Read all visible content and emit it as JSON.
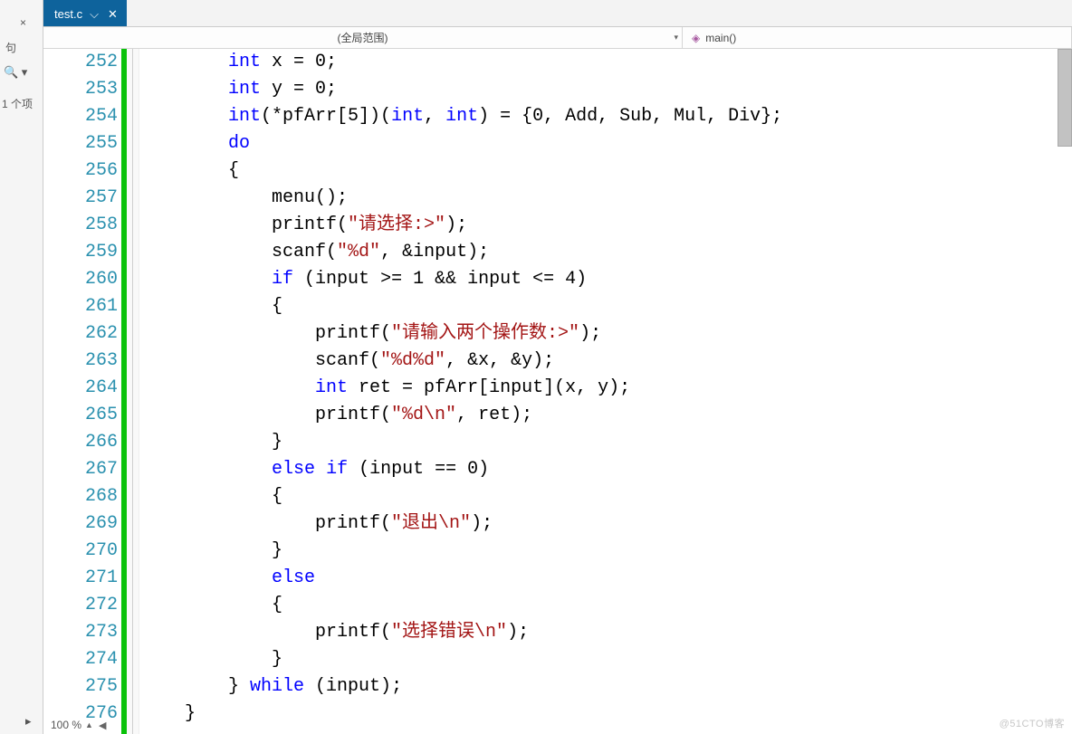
{
  "left_panel": {
    "close_x": "×",
    "char_label": "句",
    "search_glyph": "🔍 ▾",
    "project_fragment": "1 个项",
    "expand_glyph": "▸"
  },
  "tabs": {
    "active": {
      "label": "test.c",
      "pin_glyph": "⌵",
      "close_glyph": "✕"
    }
  },
  "scope_bar": {
    "global_label": "(全局范围)",
    "func_icon": "◈",
    "func_label": "main()",
    "drop_glyph": "▾"
  },
  "code": [
    {
      "num": 252,
      "seg": [
        {
          "t": "        "
        },
        {
          "t": "int",
          "c": "kw"
        },
        {
          "t": " x = 0;"
        }
      ]
    },
    {
      "num": 253,
      "seg": [
        {
          "t": "        "
        },
        {
          "t": "int",
          "c": "kw"
        },
        {
          "t": " y = 0;"
        }
      ]
    },
    {
      "num": 254,
      "seg": [
        {
          "t": "        "
        },
        {
          "t": "int",
          "c": "kw"
        },
        {
          "t": "(*pfArr[5])("
        },
        {
          "t": "int",
          "c": "kw"
        },
        {
          "t": ", "
        },
        {
          "t": "int",
          "c": "kw"
        },
        {
          "t": ") = {0, Add, Sub, Mul, Div};"
        }
      ]
    },
    {
      "num": 255,
      "seg": [
        {
          "t": "        "
        },
        {
          "t": "do",
          "c": "kw"
        }
      ]
    },
    {
      "num": 256,
      "seg": [
        {
          "t": "        {"
        }
      ]
    },
    {
      "num": 257,
      "seg": [
        {
          "t": "            menu();"
        }
      ]
    },
    {
      "num": 258,
      "seg": [
        {
          "t": "            printf("
        },
        {
          "t": "\"请选择:>\"",
          "c": "str"
        },
        {
          "t": ");"
        }
      ]
    },
    {
      "num": 259,
      "seg": [
        {
          "t": "            scanf("
        },
        {
          "t": "\"%d\"",
          "c": "str"
        },
        {
          "t": ", &input);"
        }
      ]
    },
    {
      "num": 260,
      "seg": [
        {
          "t": "            "
        },
        {
          "t": "if",
          "c": "kw"
        },
        {
          "t": " (input >= 1 && input <= 4)"
        }
      ]
    },
    {
      "num": 261,
      "seg": [
        {
          "t": "            {"
        }
      ]
    },
    {
      "num": 262,
      "seg": [
        {
          "t": "                printf("
        },
        {
          "t": "\"请输入两个操作数:>\"",
          "c": "str"
        },
        {
          "t": ");"
        }
      ]
    },
    {
      "num": 263,
      "seg": [
        {
          "t": "                scanf("
        },
        {
          "t": "\"%d%d\"",
          "c": "str"
        },
        {
          "t": ", &x, &y);"
        }
      ]
    },
    {
      "num": 264,
      "seg": [
        {
          "t": "                "
        },
        {
          "t": "int",
          "c": "kw"
        },
        {
          "t": " ret = pfArr[input](x, y);"
        }
      ]
    },
    {
      "num": 265,
      "seg": [
        {
          "t": "                printf("
        },
        {
          "t": "\"%d\\n\"",
          "c": "str"
        },
        {
          "t": ", ret);"
        }
      ]
    },
    {
      "num": 266,
      "seg": [
        {
          "t": "            }"
        }
      ]
    },
    {
      "num": 267,
      "seg": [
        {
          "t": "            "
        },
        {
          "t": "else",
          "c": "kw"
        },
        {
          "t": " "
        },
        {
          "t": "if",
          "c": "kw"
        },
        {
          "t": " (input == 0)"
        }
      ]
    },
    {
      "num": 268,
      "seg": [
        {
          "t": "            {"
        }
      ]
    },
    {
      "num": 269,
      "seg": [
        {
          "t": "                printf("
        },
        {
          "t": "\"退出\\n\"",
          "c": "str"
        },
        {
          "t": ");"
        }
      ]
    },
    {
      "num": 270,
      "seg": [
        {
          "t": "            }"
        }
      ]
    },
    {
      "num": 271,
      "seg": [
        {
          "t": "            "
        },
        {
          "t": "else",
          "c": "kw"
        }
      ]
    },
    {
      "num": 272,
      "seg": [
        {
          "t": "            {"
        }
      ]
    },
    {
      "num": 273,
      "seg": [
        {
          "t": "                printf("
        },
        {
          "t": "\"选择错误\\n\"",
          "c": "str"
        },
        {
          "t": ");"
        }
      ]
    },
    {
      "num": 274,
      "seg": [
        {
          "t": "            }"
        }
      ]
    },
    {
      "num": 275,
      "seg": [
        {
          "t": "        } "
        },
        {
          "t": "while",
          "c": "kw"
        },
        {
          "t": " (input);"
        }
      ]
    },
    {
      "num": 276,
      "seg": [
        {
          "t": "    }"
        }
      ]
    }
  ],
  "status": {
    "zoom": "100 %",
    "tri": "▲",
    "arrow": "◀"
  },
  "watermark": "@51CTO博客"
}
